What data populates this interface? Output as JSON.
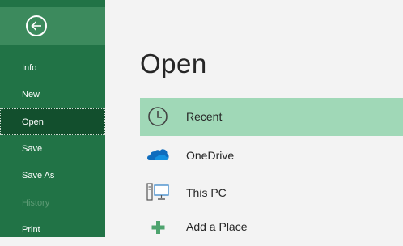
{
  "sidebar": {
    "items": [
      {
        "label": "Info"
      },
      {
        "label": "New"
      },
      {
        "label": "Open"
      },
      {
        "label": "Save"
      },
      {
        "label": "Save As"
      },
      {
        "label": "History"
      },
      {
        "label": "Print"
      }
    ]
  },
  "main": {
    "title": "Open",
    "locations": [
      {
        "label": "Recent",
        "icon": "clock-icon"
      },
      {
        "label": "OneDrive",
        "icon": "cloud-icon"
      },
      {
        "label": "This PC",
        "icon": "computer-icon"
      },
      {
        "label": "Add a Place",
        "icon": "plus-icon"
      }
    ]
  },
  "colors": {
    "sidebar": "#217346",
    "selected_nav": "#124f2d",
    "selected_location": "#a0d8b7",
    "onedrive": "#0f6cbd"
  }
}
